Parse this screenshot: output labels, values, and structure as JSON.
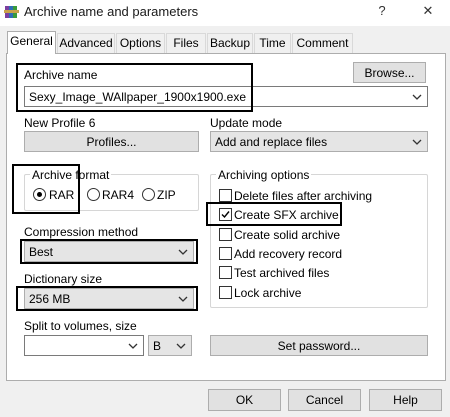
{
  "window": {
    "title": "Archive name and parameters",
    "help_glyph": "?",
    "close_glyph": "✕"
  },
  "tabs": [
    "General",
    "Advanced",
    "Options",
    "Files",
    "Backup",
    "Time",
    "Comment"
  ],
  "active_tab": "General",
  "archive_name": {
    "label": "Archive name",
    "value": "Sexy_Image_WAllpaper_1900x1900.exe",
    "browse_label": "Browse..."
  },
  "profile": {
    "label": "New Profile 6",
    "button_label": "Profiles..."
  },
  "update_mode": {
    "label": "Update mode",
    "value": "Add and replace files"
  },
  "archive_format": {
    "label": "Archive format",
    "options": [
      "RAR",
      "RAR4",
      "ZIP"
    ],
    "selected": "RAR"
  },
  "archiving_options": {
    "label": "Archiving options",
    "items": [
      {
        "label": "Delete files after archiving",
        "checked": false
      },
      {
        "label": "Create SFX archive",
        "checked": true
      },
      {
        "label": "Create solid archive",
        "checked": false
      },
      {
        "label": "Add recovery record",
        "checked": false
      },
      {
        "label": "Test archived files",
        "checked": false
      },
      {
        "label": "Lock archive",
        "checked": false
      }
    ]
  },
  "compression": {
    "label": "Compression method",
    "value": "Best"
  },
  "dictionary": {
    "label": "Dictionary size",
    "value": "256 MB"
  },
  "split": {
    "label": "Split to volumes, size",
    "value": "",
    "unit": "B"
  },
  "set_password_label": "Set password...",
  "footer": {
    "ok": "OK",
    "cancel": "Cancel",
    "help": "Help"
  },
  "icons": {
    "app": "winrar-books-icon",
    "dropdown": "chevron-down-icon",
    "checkmark": "checkmark-icon"
  },
  "colors": {
    "background": "#f0f0f0",
    "panel": "#ffffff",
    "highlight_box": "#000000",
    "button": "#e1e1e1"
  }
}
